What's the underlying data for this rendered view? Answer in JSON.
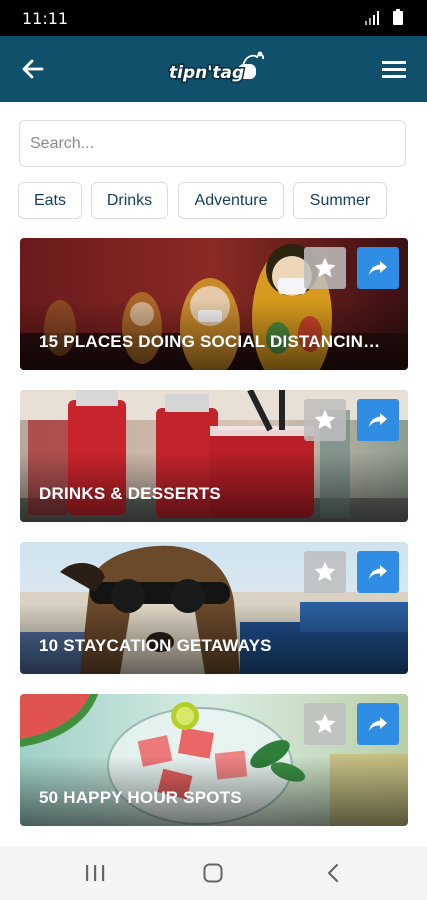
{
  "status_bar": {
    "time": "11:11"
  },
  "header": {
    "logo_text": "tipn'tag"
  },
  "search": {
    "placeholder": "Search..."
  },
  "chips": [
    "Eats",
    "Drinks",
    "Adventure",
    "Summer"
  ],
  "cards": [
    {
      "title": "15 PLACES DOING SOCIAL DISTANCIN…"
    },
    {
      "title": "DRINKS & DESSERTS"
    },
    {
      "title": "10 STAYCATION GETAWAYS"
    },
    {
      "title": "50 HAPPY HOUR SPOTS"
    }
  ],
  "colors": {
    "header_bg": "#11506b",
    "share_button": "#2f8de4",
    "chip_text": "#163d5e"
  },
  "icons": {
    "back": "back-arrow-icon",
    "menu": "hamburger-menu-icon",
    "favorite": "star-icon",
    "share": "share-arrow-icon",
    "nav_recent": "recent-apps-icon",
    "nav_home": "home-icon",
    "nav_back": "nav-back-icon"
  }
}
